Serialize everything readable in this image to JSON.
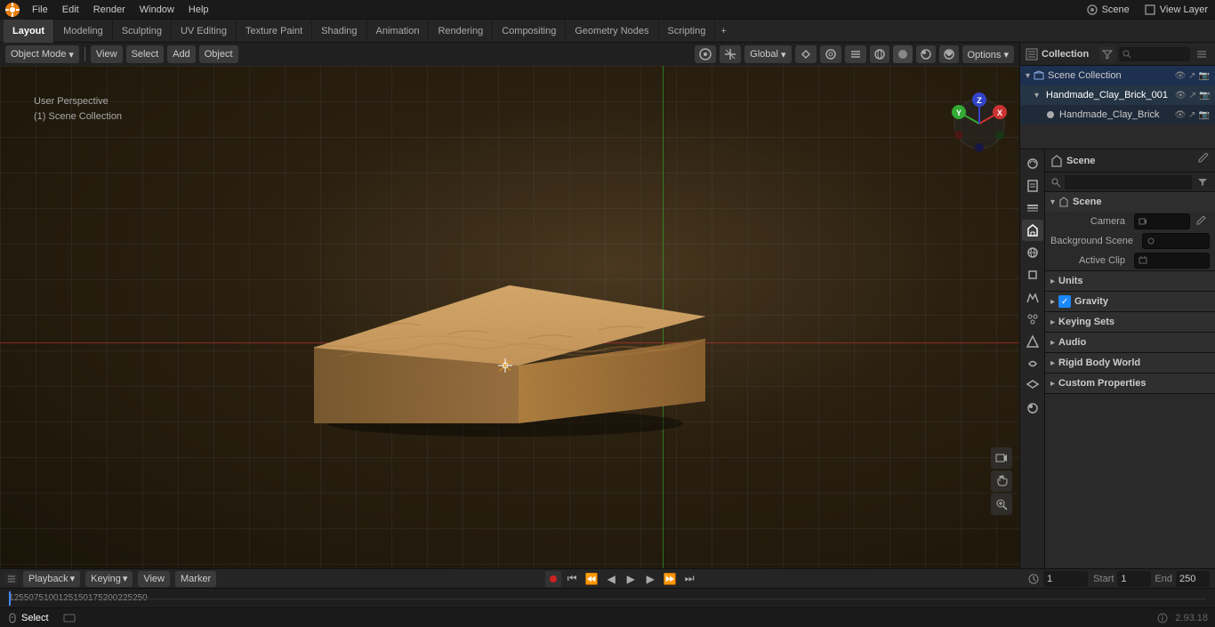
{
  "app": {
    "title": "Blender",
    "version": "2.93.18"
  },
  "menu": {
    "items": [
      "File",
      "Edit",
      "Render",
      "Window",
      "Help"
    ]
  },
  "workspace_tabs": {
    "tabs": [
      "Layout",
      "Modeling",
      "Sculpting",
      "UV Editing",
      "Texture Paint",
      "Shading",
      "Animation",
      "Rendering",
      "Compositing",
      "Geometry Nodes",
      "Scripting"
    ],
    "active": "Layout"
  },
  "viewport": {
    "mode": "Object Mode",
    "view_label": "View",
    "select_label": "Select",
    "add_label": "Add",
    "object_label": "Object",
    "perspective_label": "User Perspective",
    "collection_label": "(1) Scene Collection",
    "transform": "Global",
    "scene_name": "Scene",
    "view_layer": "View Layer"
  },
  "outliner": {
    "title": "Collection",
    "items": [
      {
        "name": "Handmade_Clay_Brick_001",
        "indent": 1,
        "expanded": true,
        "children": [
          {
            "name": "Handmade_Clay_Brick",
            "indent": 2,
            "expanded": false,
            "children": []
          }
        ]
      }
    ]
  },
  "properties": {
    "scene_header": "Scene",
    "scene_section": {
      "title": "Scene",
      "camera_label": "Camera",
      "camera_value": "",
      "background_scene_label": "Background Scene",
      "active_clip_label": "Active Clip"
    },
    "units_label": "Units",
    "gravity_label": "Gravity",
    "gravity_checked": true,
    "keying_sets_label": "Keying Sets",
    "audio_label": "Audio",
    "rigid_body_world_label": "Rigid Body World",
    "custom_properties_label": "Custom Properties"
  },
  "timeline": {
    "playback_label": "Playback",
    "keying_label": "Keying",
    "view_label": "View",
    "marker_label": "Marker",
    "frame_current": "1",
    "frame_start_label": "Start",
    "frame_start": "1",
    "frame_end_label": "End",
    "frame_end": "250"
  },
  "status_bar": {
    "select_label": "Select",
    "version": "2.93.18"
  },
  "scrubber": {
    "marks": [
      "1",
      "25",
      "50",
      "75",
      "100",
      "125",
      "150",
      "175",
      "200",
      "225",
      "250"
    ]
  }
}
